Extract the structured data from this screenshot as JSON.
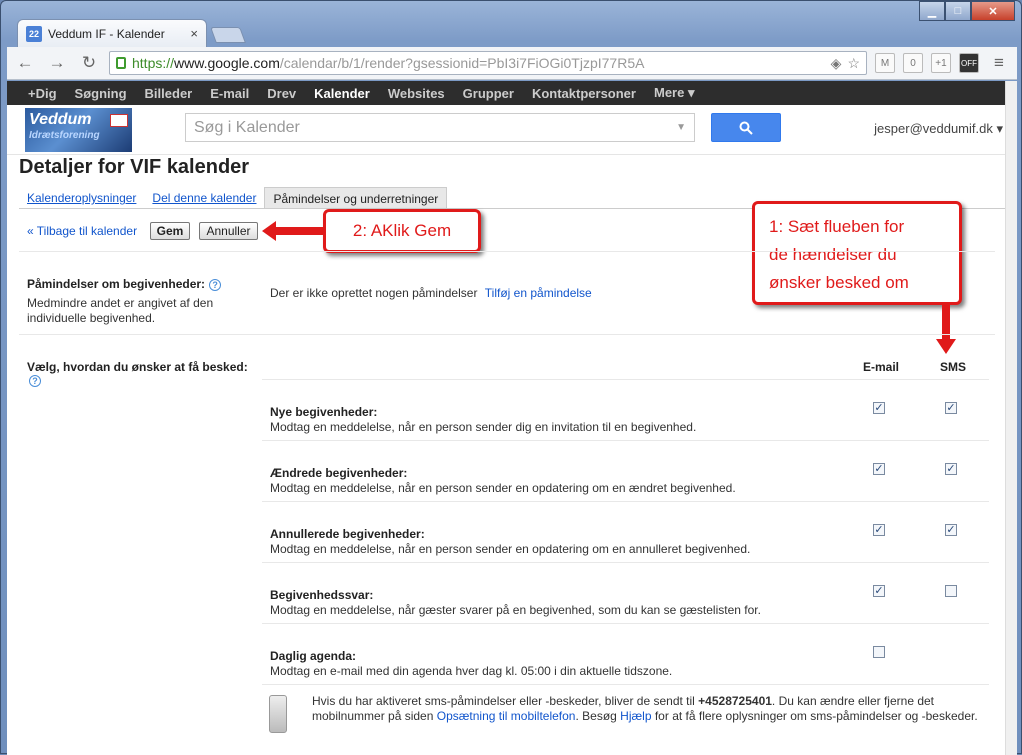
{
  "browser": {
    "tab_title": "Veddum IF - Kalender",
    "favicon_text": "22",
    "url_scheme": "https://",
    "url_host": "www.google.com",
    "url_path": "/calendar/b/1/render?gsessionid=PbI3i7FiOGi0TjzpI77R5A",
    "badge_count": "0"
  },
  "gbar": [
    "+Dig",
    "Søgning",
    "Billeder",
    "E-mail",
    "Drev",
    "Kalender",
    "Websites",
    "Grupper",
    "Kontaktpersoner",
    "Mere ▾"
  ],
  "gbar_active": "Kalender",
  "header": {
    "logo_text": "Veddum",
    "logo_sub": "Idrætsforening",
    "search_placeholder": "Søg i Kalender",
    "user": "jesper@veddumif.dk ▾"
  },
  "page": {
    "title": "Detaljer for VIF kalender",
    "tabs": [
      "Kalenderoplysninger",
      "Del denne kalender",
      "Påmindelser og underretninger"
    ],
    "back": "« Tilbage til kalender",
    "save": "Gem",
    "cancel": "Annuller"
  },
  "callouts": {
    "step2": "2: AKlik  Gem",
    "step1_l1": "1: Sæt flueben for",
    "step1_l2": "de hændelser du",
    "step1_l3": "ønsker besked om"
  },
  "reminders": {
    "label": "Påmindelser om begivenheder:",
    "desc_l1": "Medmindre andet er angivet af den",
    "desc_l2": "individuelle begivenhed.",
    "none": "Der er ikke oprettet nogen påmindelser",
    "add": "Tilføj en påmindelse"
  },
  "notify": {
    "label": "Vælg, hvordan du ønsker at få besked:",
    "col_email": "E-mail",
    "col_sms": "SMS",
    "rows": [
      {
        "title": "Nye begivenheder:",
        "desc": "Modtag en meddelelse, når en person sender dig en invitation til en begivenhed.",
        "email": true,
        "sms": true
      },
      {
        "title": "Ændrede begivenheder:",
        "desc": "Modtag en meddelelse, når en person sender en opdatering om en ændret begivenhed.",
        "email": true,
        "sms": true
      },
      {
        "title": "Annullerede begivenheder:",
        "desc": "Modtag en meddelelse, når en person sender en opdatering om en annulleret begivenhed.",
        "email": true,
        "sms": true
      },
      {
        "title": "Begivenhedssvar:",
        "desc": "Modtag en meddelelse, når gæster svarer på en begivenhed, som du kan se gæstelisten for.",
        "email": true,
        "sms": false
      },
      {
        "title": "Daglig agenda:",
        "desc": "Modtag en e-mail med din agenda hver dag kl. 05:00 i din aktuelle tidszone.",
        "email": false,
        "sms": null
      }
    ]
  },
  "sms_info": {
    "p1": "Hvis du har aktiveret sms-påmindelser eller -beskeder, bliver de sendt til ",
    "phone": "+4528725401",
    "p2": ". Du kan ændre eller fjerne det mobilnummer på siden ",
    "link1": "Opsætning til mobiltelefon",
    "p3": ". Besøg ",
    "link2": "Hjælp",
    "p4": " for at få flere oplysninger om sms-påmindelser og -beskeder."
  }
}
